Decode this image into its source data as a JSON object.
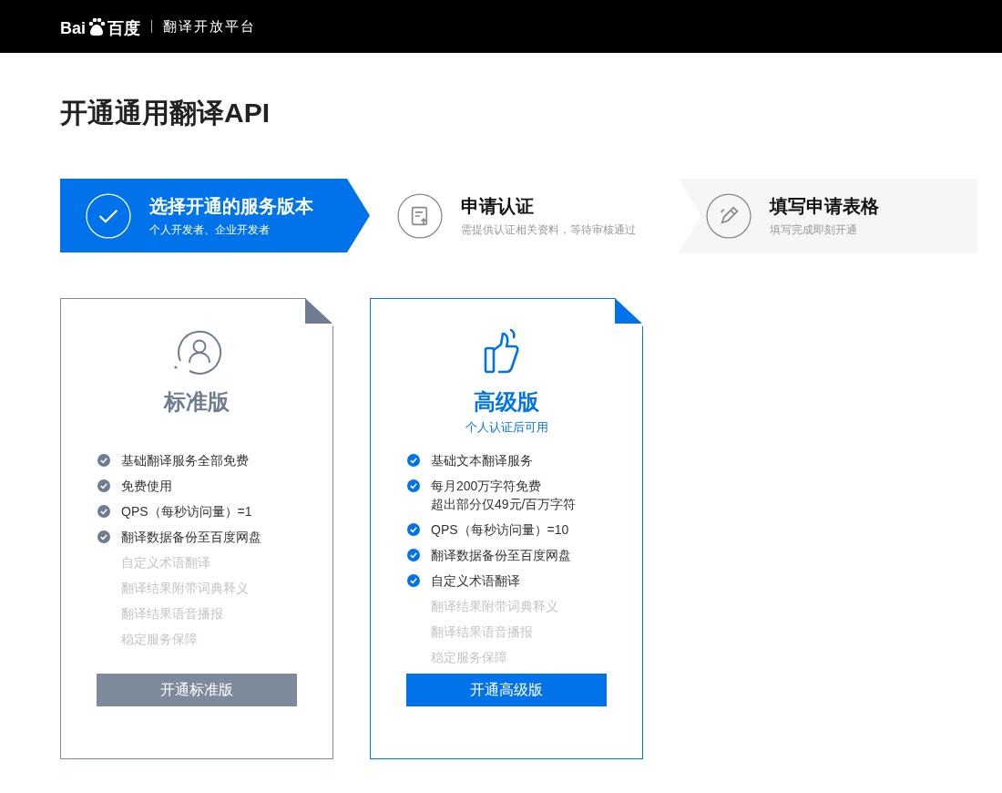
{
  "header": {
    "logo_latin": "Bai",
    "logo_cn": "百度",
    "product": "翻译开放平台"
  },
  "title": "开通通用翻译API",
  "steps": [
    {
      "title": "选择开通的服务版本",
      "subtitle": "个人开发者、企业开发者",
      "selected": true
    },
    {
      "title": "申请认证",
      "subtitle": "需提供认证相关资料，等待审核通过",
      "selected": false
    },
    {
      "title": "填写申请表格",
      "subtitle": "填写完成即刻开通",
      "selected": false
    }
  ],
  "plans": [
    {
      "name": "标准版",
      "highlighted": false,
      "button": "开通标准版",
      "features": [
        {
          "text": "基础翻译服务全部免费",
          "included": true
        },
        {
          "text": "免费使用",
          "included": true
        },
        {
          "text": "QPS（每秒访问量）=1",
          "included": true
        },
        {
          "text": "翻译数据备份至百度网盘",
          "included": true
        },
        {
          "text": "自定义术语翻译",
          "included": false
        },
        {
          "text": "翻译结果附带词典释义",
          "included": false
        },
        {
          "text": "翻译结果语音播报",
          "included": false
        },
        {
          "text": "稳定服务保障",
          "included": false
        }
      ]
    },
    {
      "name": "高级版",
      "subtitle": "个人认证后可用",
      "highlighted": true,
      "button": "开通高级版",
      "features": [
        {
          "text": "基础文本翻译服务",
          "included": true
        },
        {
          "text": "每月200万字符免费",
          "note": "超出部分仅49元/百万字符",
          "included": true
        },
        {
          "text": "QPS（每秒访问量）=10",
          "included": true
        },
        {
          "text": "翻译数据备份至百度网盘",
          "included": true
        },
        {
          "text": "自定义术语翻译",
          "included": true
        },
        {
          "text": "翻译结果附带词典释义",
          "included": false
        },
        {
          "text": "翻译结果语音播报",
          "included": false
        },
        {
          "text": "稳定服务保障",
          "included": false
        }
      ]
    }
  ]
}
